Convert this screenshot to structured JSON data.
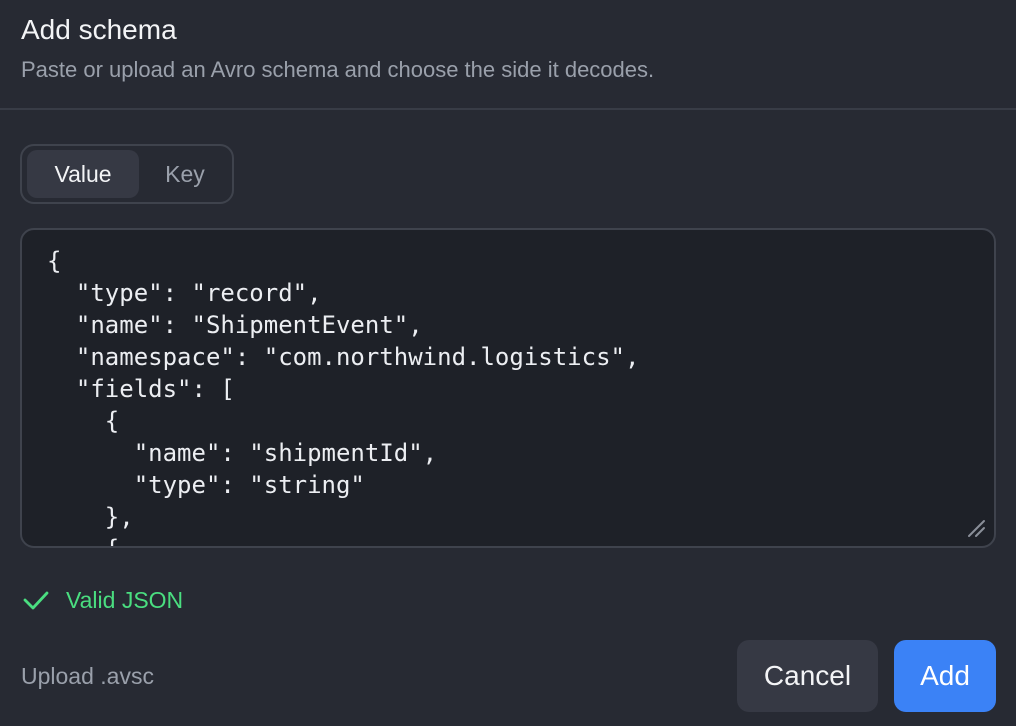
{
  "dialog": {
    "title": "Add schema",
    "subtitle": "Paste or upload an Avro schema and choose the side it decodes."
  },
  "side_toggle": {
    "options": [
      "Value",
      "Key"
    ],
    "selected": "Value"
  },
  "editor": {
    "content": "{\n  \"type\": \"record\",\n  \"name\": \"ShipmentEvent\",\n  \"namespace\": \"com.northwind.logistics\",\n  \"fields\": [\n    {\n      \"name\": \"shipmentId\",\n      \"type\": \"string\"\n    },\n    {"
  },
  "validation": {
    "icon": "check-icon",
    "text": "Valid JSON",
    "color": "#4ade80"
  },
  "footer": {
    "upload_label": "Upload .avsc",
    "cancel_label": "Cancel",
    "add_label": "Add"
  },
  "colors": {
    "background": "#272a33",
    "editor_background": "#1e2128",
    "accent": "#3b82f6",
    "success": "#4ade80"
  }
}
